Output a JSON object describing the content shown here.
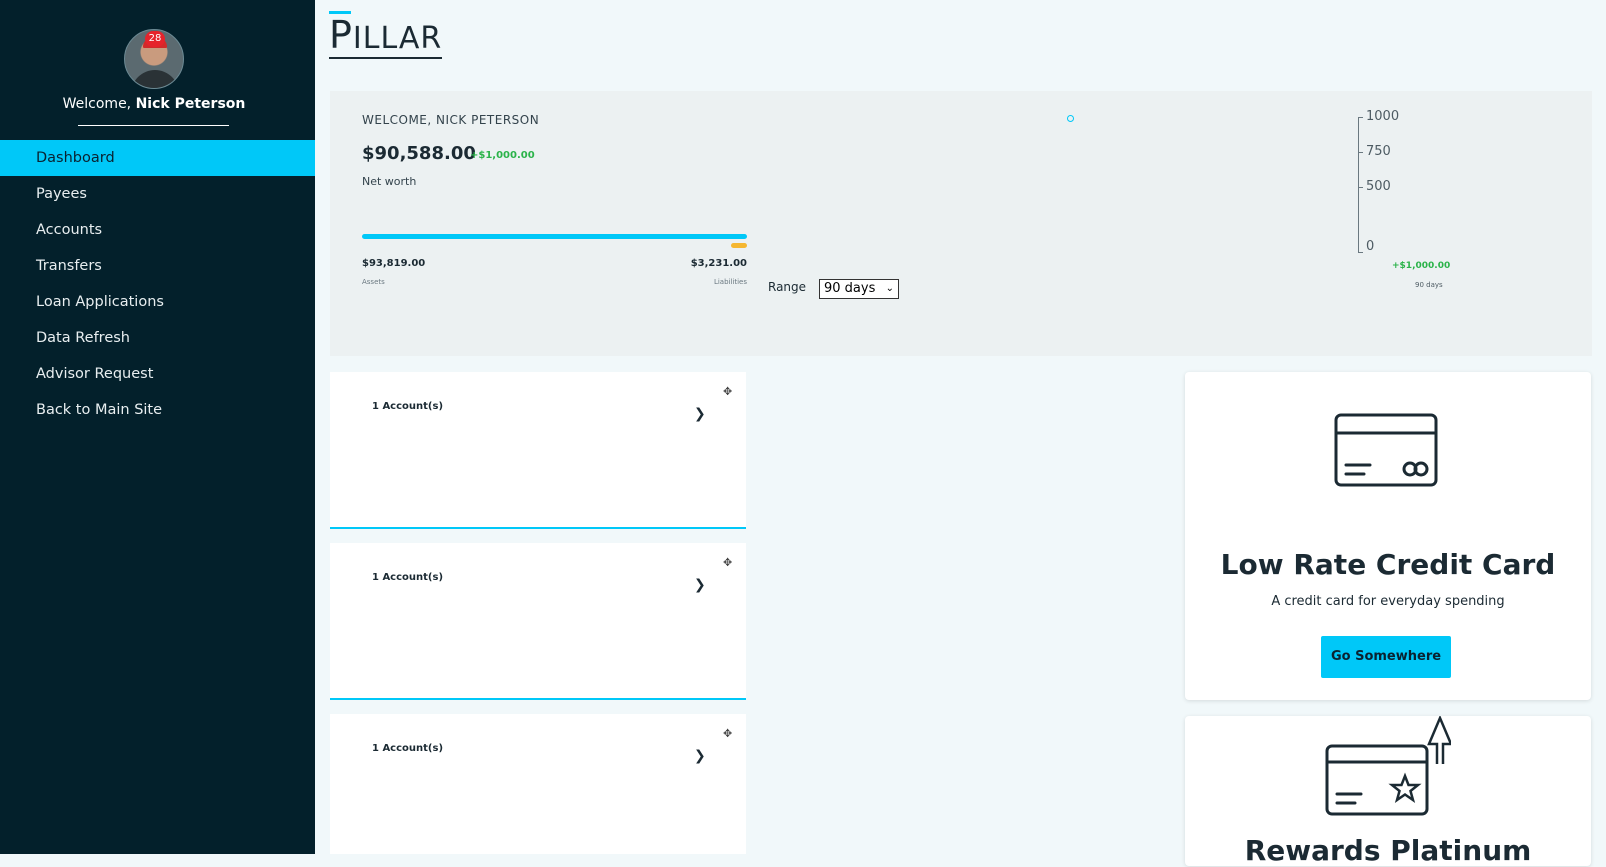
{
  "sidebar": {
    "badge": "28",
    "welcome_prefix": "Welcome,",
    "user_name": "Nick Peterson",
    "items": [
      {
        "label": "Dashboard",
        "active": true
      },
      {
        "label": "Payees"
      },
      {
        "label": "Accounts"
      },
      {
        "label": "Transfers"
      },
      {
        "label": "Loan Applications"
      },
      {
        "label": "Data Refresh"
      },
      {
        "label": "Advisor Request"
      },
      {
        "label": "Back to Main Site"
      }
    ]
  },
  "brand": {
    "first": "P",
    "rest": "ILLAR"
  },
  "summary": {
    "welcome": "WELCOME, NICK PETERSON",
    "net_worth": "$90,588.00",
    "net_worth_delta": "+$1,000.00",
    "net_worth_label": "Net worth",
    "assets_value": "$93,819.00",
    "assets_label": "Assets",
    "liabilities_value": "$3,231.00",
    "liabilities_label": "Liabilities",
    "range_label": "Range",
    "range_value": "90 days"
  },
  "chart_data": {
    "type": "line",
    "ytick_labels": [
      "1000",
      "750",
      "500",
      "0"
    ],
    "delta": "+$1,000.00",
    "period": "90 days"
  },
  "accounts": [
    {
      "title": "1 Account(s)"
    },
    {
      "title": "1 Account(s)"
    },
    {
      "title": "1 Account(s)"
    }
  ],
  "products": [
    {
      "title": "Low Rate Credit Card",
      "desc": "A credit card for everyday spending",
      "button": "Go Somewhere"
    },
    {
      "title": "Rewards Platinum"
    }
  ],
  "colors": {
    "accent": "#00c8f8",
    "sidebar": "#03202b",
    "positive": "#2bb34a",
    "liability": "#f5b731"
  }
}
